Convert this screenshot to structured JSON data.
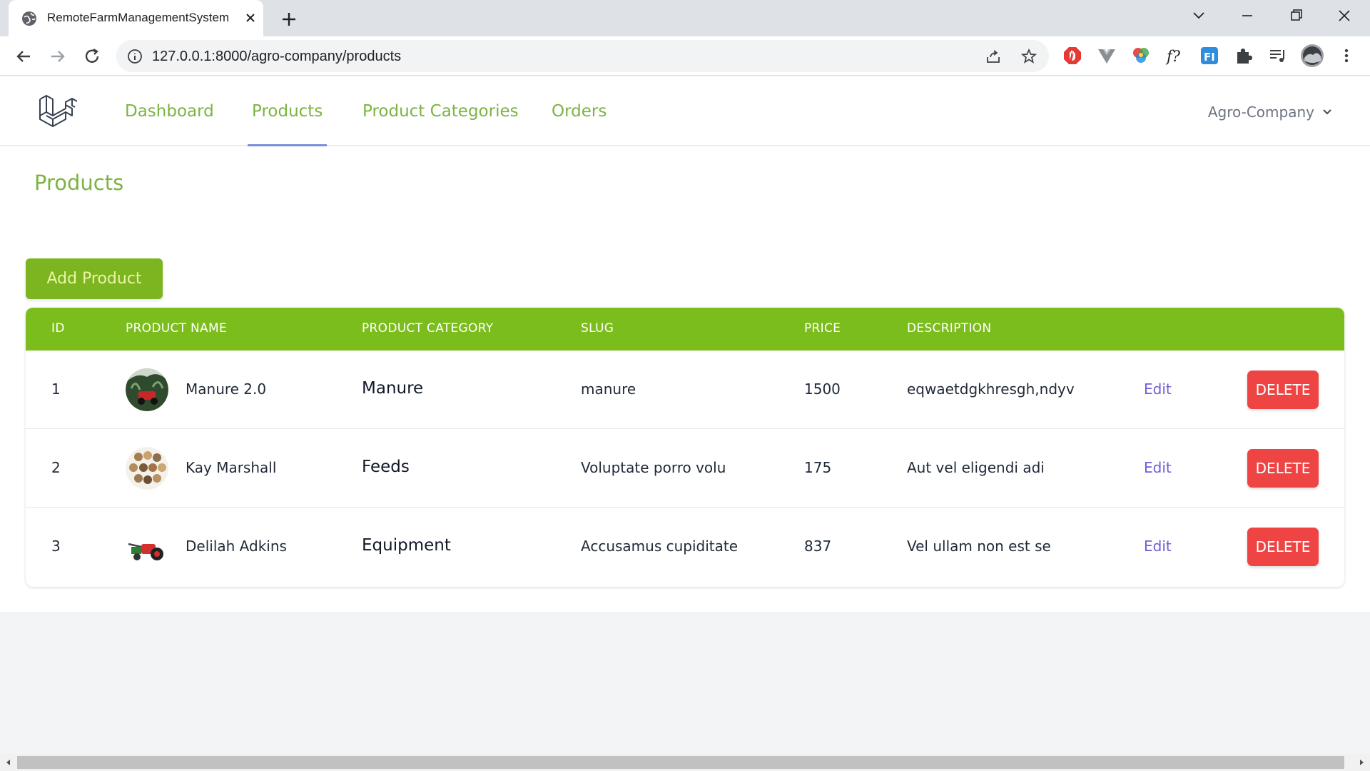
{
  "browser": {
    "tab_title": "RemoteFarmManagementSystem",
    "url": "127.0.0.1:8000/agro-company/products"
  },
  "nav": {
    "links": [
      "Dashboard",
      "Products",
      "Product Categories",
      "Orders"
    ],
    "active": "Products",
    "user": "Agro-Company"
  },
  "page": {
    "title": "Products",
    "add_button": "Add Product"
  },
  "table": {
    "headers": [
      "ID",
      "PRODUCT NAME",
      "PRODUCT CATEGORY",
      "SLUG",
      "PRICE",
      "DESCRIPTION"
    ],
    "rows": [
      {
        "id": "1",
        "name": "Manure 2.0",
        "category": "Manure",
        "slug": "manure",
        "price": "1500",
        "description": "eqwaetdgkhresgh,ndyv",
        "edit": "Edit",
        "delete": "DELETE"
      },
      {
        "id": "2",
        "name": "Kay Marshall",
        "category": "Feeds",
        "slug": "Voluptate porro volu",
        "price": "175",
        "description": "Aut vel eligendi adi",
        "edit": "Edit",
        "delete": "DELETE"
      },
      {
        "id": "3",
        "name": "Delilah Adkins",
        "category": "Equipment",
        "slug": "Accusamus cupiditate",
        "price": "837",
        "description": "Vel ullam non est se",
        "edit": "Edit",
        "delete": "DELETE"
      }
    ]
  },
  "colors": {
    "brand_green": "#7cbd1e",
    "link_green": "#7cb342",
    "delete_red": "#ef4444",
    "edit_purple": "#6d5fd6"
  },
  "icons": {
    "favicon": "globe-icon",
    "logo": "laravel-logo-icon",
    "user_menu": "chevron-down-icon"
  }
}
